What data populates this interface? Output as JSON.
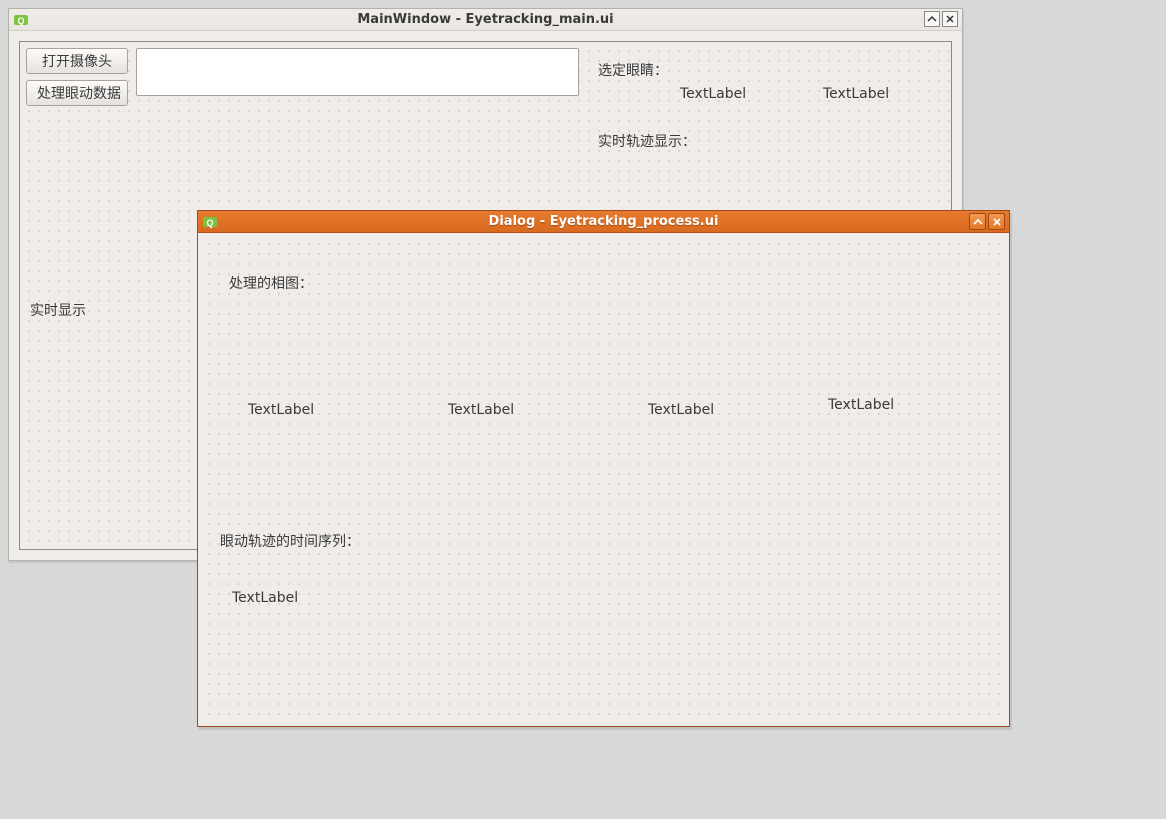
{
  "main_window": {
    "title": "MainWindow - Eyetracking_main.ui",
    "buttons": {
      "open_camera": "打开摄像头",
      "process_data": "处理眼动数据"
    },
    "labels": {
      "select_eyes": "选定眼睛：",
      "eye_label_1": "TextLabel",
      "eye_label_2": "TextLabel",
      "realtime_trajectory": "实时轨迹显示：",
      "realtime_display": "实时显示"
    }
  },
  "dialog": {
    "title": "Dialog - Eyetracking_process.ui",
    "labels": {
      "processed_figure": "处理的相图：",
      "fig_label_1": "TextLabel",
      "fig_label_2": "TextLabel",
      "fig_label_3": "TextLabel",
      "fig_label_4": "TextLabel",
      "time_series": "眼动轨迹的时间序列：",
      "series_label_1": "TextLabel"
    }
  }
}
